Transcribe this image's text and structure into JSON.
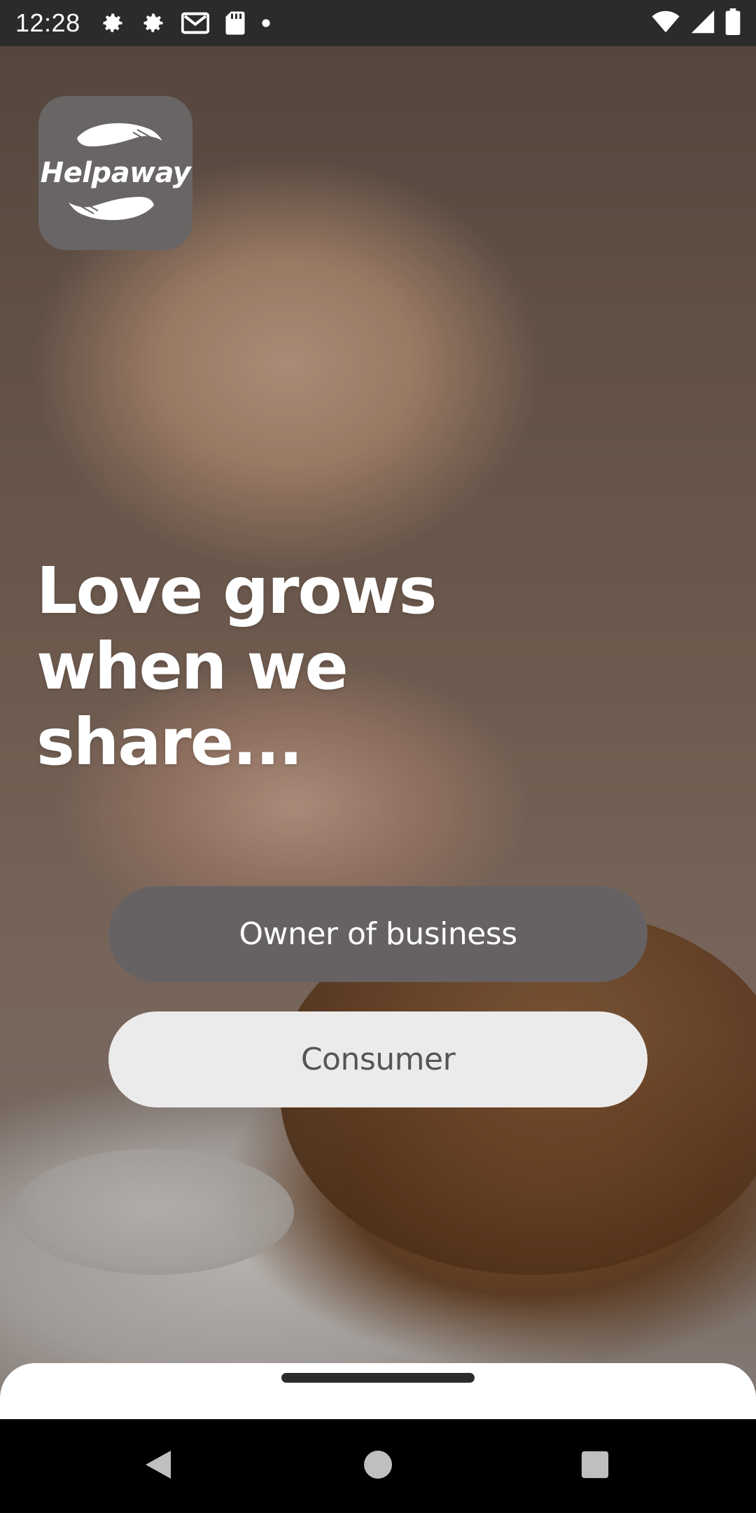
{
  "status_bar": {
    "time": "12:28",
    "left_icons": [
      "settings-icon",
      "settings-icon",
      "gmail-icon",
      "sd-card-icon",
      "dot-icon"
    ],
    "right_icons": [
      "wifi-icon",
      "cell-signal-icon",
      "battery-icon"
    ]
  },
  "logo": {
    "text": "Helpaway",
    "icon": "helping-hands-icon",
    "background": "#6a6565"
  },
  "hero": {
    "headline_lines": [
      "Love grows",
      "when we",
      "share..."
    ]
  },
  "actions": {
    "owner_label": "Owner of business",
    "consumer_label": "Consumer"
  },
  "nav": {
    "back": "back-icon",
    "home": "home-icon",
    "recents": "recents-icon"
  },
  "colors": {
    "owner_button": "#666263",
    "consumer_button": "#ecebeb",
    "status_bar": "#2b2b2b"
  }
}
